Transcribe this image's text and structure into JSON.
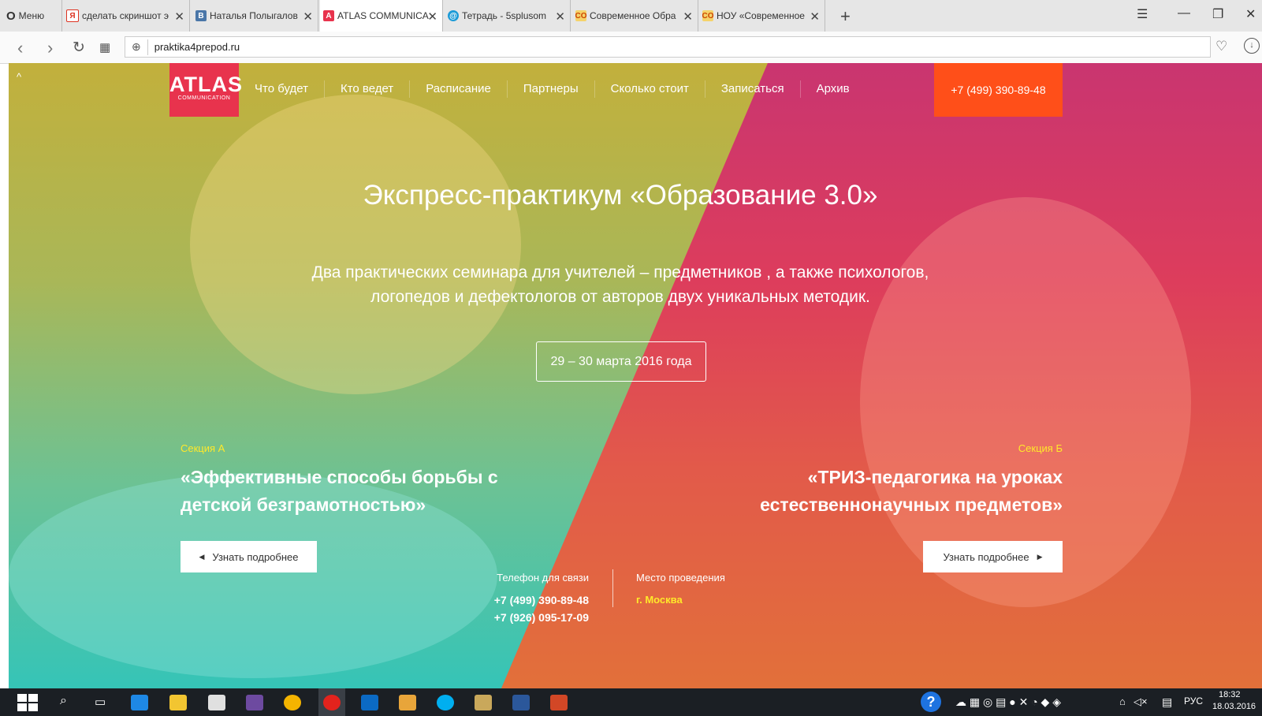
{
  "browser": {
    "menu_label": "Меню",
    "tabs": [
      {
        "title": "сделать скриншот э",
        "favicon": "Я",
        "color": "#fff",
        "fg": "#d32"
      },
      {
        "title": "Наталья Полыгалов",
        "favicon": "В",
        "color": "#4a76a8",
        "fg": "#fff"
      },
      {
        "title": "ATLAS COMMUNICA",
        "favicon": "A",
        "color": "#e8334d",
        "fg": "#fff"
      },
      {
        "title": "Тетрадь - 5splusom",
        "favicon": "@",
        "color": "#1c9bd7",
        "fg": "#fff"
      },
      {
        "title": "Современное Обра",
        "favicon": "CO",
        "color": "#f2a100",
        "fg": "#c40"
      },
      {
        "title": "НОУ «Современное",
        "favicon": "CO",
        "color": "#f2a100",
        "fg": "#c40"
      }
    ],
    "url": "praktika4prepod.ru"
  },
  "site": {
    "logo_main": "ATLAS",
    "logo_sub": "COMMUNICATION",
    "nav": [
      "Что будет",
      "Кто ведет",
      "Расписание",
      "Партнеры",
      "Сколько стоит",
      "Записаться",
      "Архив"
    ],
    "phone": "+7 (499) 390-89-48",
    "title": "Экспресс-практикум «Образование 3.0»",
    "subtitle_line1": "Два практических семинара для учителей – предметников , а также психологов,",
    "subtitle_line2": "логопедов и дефектологов от авторов двух уникальных методик.",
    "dates": "29 – 30 марта 2016 года",
    "section_a": {
      "label": "Секция А",
      "title_line1": "«Эффективные способы борьбы с",
      "title_line2": "детской безграмотностью»",
      "button": "Узнать подробнее"
    },
    "section_b": {
      "label": "Секция Б",
      "title_line1": "«ТРИЗ-педагогика на уроках",
      "title_line2": "естественнонаучных предметов»",
      "button": "Узнать подробнее"
    },
    "contacts": {
      "phone_label": "Телефон для связи",
      "phone1": "+7 (499) 390-89-48",
      "phone2": "+7 (926) 095-17-09",
      "place_label": "Место проведения",
      "place": "г. Москва"
    }
  },
  "taskbar": {
    "lang": "РУС",
    "time": "18:32",
    "date": "18.03.2016"
  }
}
